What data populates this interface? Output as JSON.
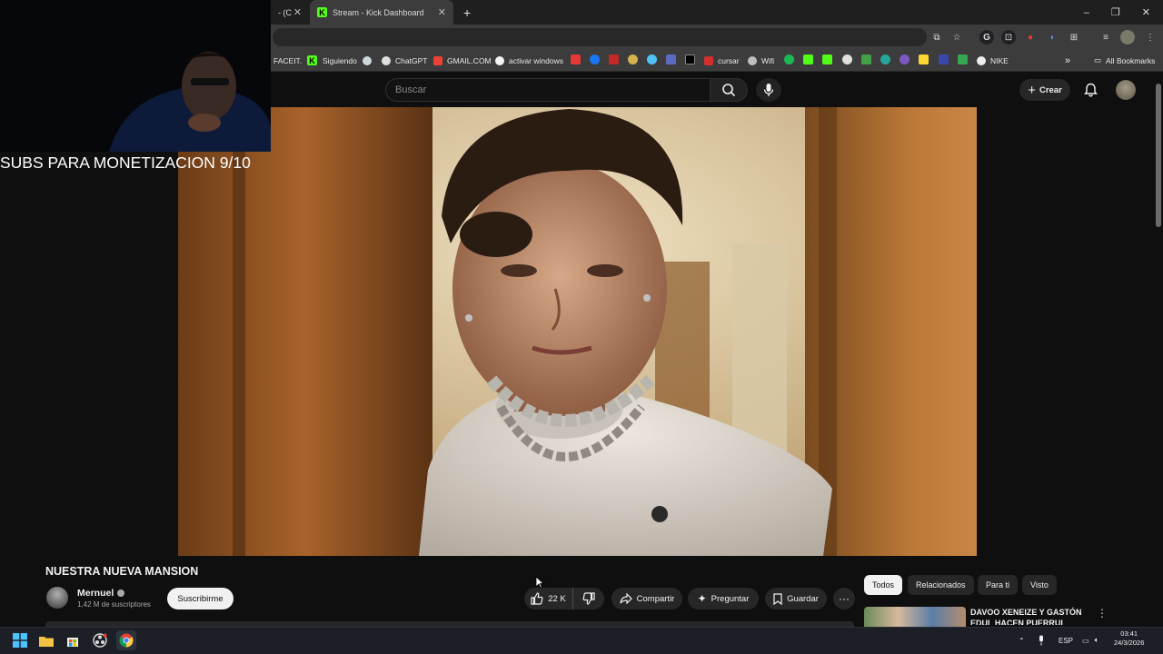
{
  "browser": {
    "tabs": [
      {
        "label": "- (C",
        "active": false
      },
      {
        "label": "Stream - Kick Dashboard",
        "active": true
      }
    ],
    "new_tab": "+",
    "window_controls": [
      "–",
      "❐",
      "✕"
    ],
    "bookmarks": [
      {
        "label": "FACEIT."
      },
      {
        "label": "Siguiendo",
        "icon": "kick-icon"
      },
      {
        "label": "ChatGPT",
        "icon": "chatgpt-icon"
      },
      {
        "label": "GMAIL.COM",
        "icon": "gmail-icon"
      },
      {
        "label": "activar windows",
        "icon": "github-icon"
      },
      {
        "label": "cursar",
        "icon": "cursar-icon"
      },
      {
        "label": "Wifi",
        "icon": "wifi-icon"
      },
      {
        "label": "NIKE",
        "icon": "nike-icon"
      }
    ],
    "all_bookmarks": "All Bookmarks",
    "bookmarks_overflow": "»"
  },
  "youtube": {
    "search_placeholder": "Buscar",
    "create_label": "Crear",
    "video": {
      "title": "NUESTRA NUEVA MANSION",
      "channel": "Mernuel",
      "subscribers": "1,42 M de suscriptores",
      "subscribe_label": "Suscribirme",
      "likes": "22 K",
      "share_label": "Compartir",
      "ask_label": "Preguntar",
      "save_label": "Guardar",
      "more_label": "···"
    },
    "chips": [
      "Todos",
      "Relacionados",
      "Para ti",
      "Visto"
    ],
    "recommended": {
      "title": "DAVOO XENEIZE Y GASTÓN EDUL HACEN PUERRUL"
    }
  },
  "stream_overlay": {
    "text": "SUBS PARA MONETIZACION 9/10"
  },
  "taskbar": {
    "language": "ESP",
    "time": "03:41",
    "date": "24/3/2026"
  },
  "colors": {
    "kick_green": "#53fc18",
    "youtube_bg": "#0f0f0f",
    "chrome_bg": "#3c3c3c"
  }
}
